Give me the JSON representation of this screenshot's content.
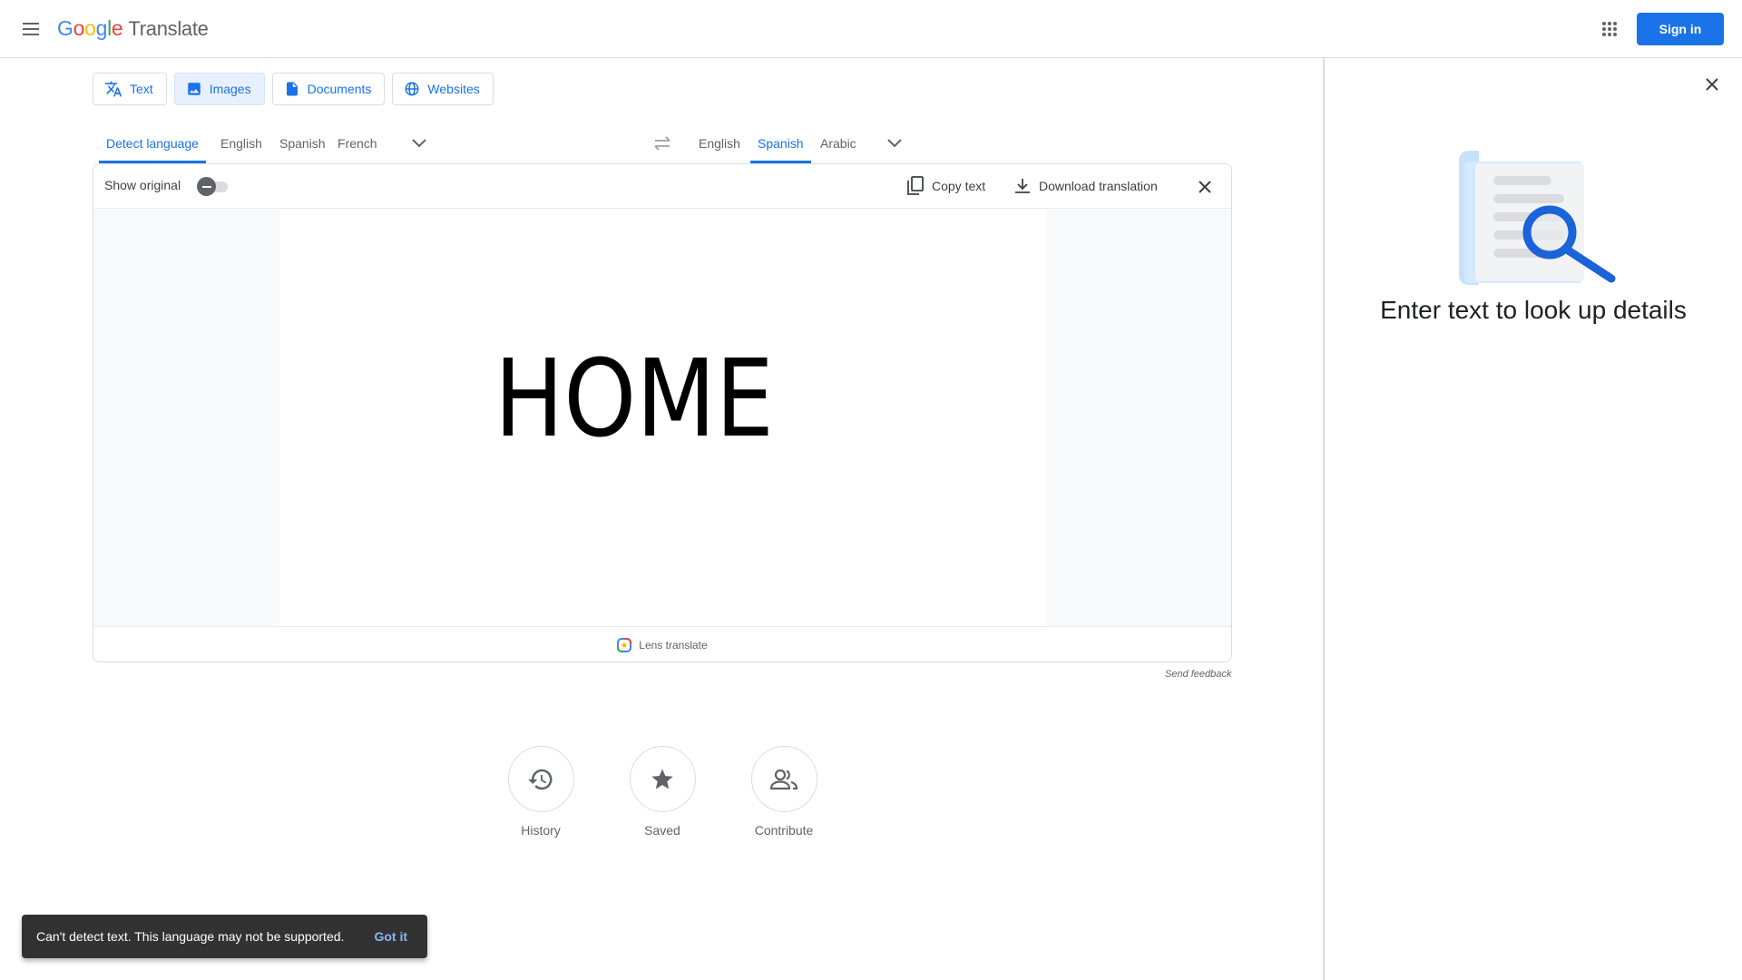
{
  "header": {
    "logo_letters": [
      "G",
      "o",
      "o",
      "g",
      "l",
      "e"
    ],
    "product": "Translate",
    "signin_label": "Sign in",
    "icons": {
      "menu": "hamburger-menu-icon",
      "apps": "apps-grid-icon"
    }
  },
  "mode_tabs": [
    {
      "label": "Text",
      "icon": "translate-icon"
    },
    {
      "label": "Images",
      "icon": "image-icon",
      "active": true
    },
    {
      "label": "Documents",
      "icon": "document-icon"
    },
    {
      "label": "Websites",
      "icon": "globe-icon"
    }
  ],
  "source_languages": [
    "Detect language",
    "English",
    "Spanish",
    "French"
  ],
  "source_active": "Detect language",
  "target_languages": [
    "English",
    "Spanish",
    "Arabic"
  ],
  "target_active": "Spanish",
  "panel": {
    "show_original_label": "Show original",
    "show_original_on": false,
    "copy_text_label": "Copy text",
    "download_label": "Download translation",
    "image_text": "HOME",
    "lens_label": "Lens translate"
  },
  "send_feedback": "Send feedback",
  "bottom_actions": [
    {
      "label": "History",
      "icon": "history-icon"
    },
    {
      "label": "Saved",
      "icon": "star-icon"
    },
    {
      "label": "Contribute",
      "icon": "people-icon"
    }
  ],
  "snackbar": {
    "message": "Can't detect text. This language may not be supported.",
    "action": "Got it"
  },
  "side_panel": {
    "title": "Enter text to look up details",
    "illustration": "document-search-illustration"
  },
  "colors": {
    "accent": "#1a73e8",
    "active_tab_bg": "#e8f0fe",
    "snackbar_bg": "#323232",
    "snackbar_action": "#8ab4f8"
  }
}
